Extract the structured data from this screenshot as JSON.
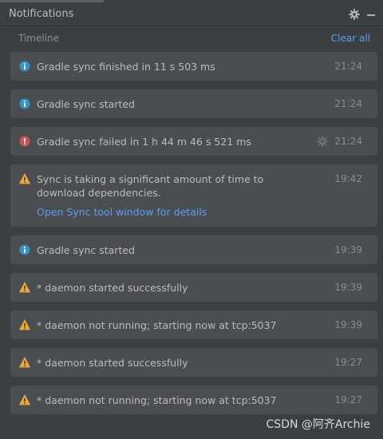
{
  "header": {
    "title": "Notifications"
  },
  "subheader": {
    "timeline_label": "Timeline",
    "clear_all_label": "Clear all"
  },
  "notifications": [
    {
      "type": "info",
      "icon": "info-icon",
      "message": "Gradle sync finished in 11 s 503 ms",
      "time": "21:24"
    },
    {
      "type": "info",
      "icon": "info-icon",
      "message": "Gradle sync started",
      "time": "21:24"
    },
    {
      "type": "error",
      "icon": "error-icon",
      "message": "Gradle sync failed in 1 h 44 m 46 s 521 ms",
      "time": "21:24"
    },
    {
      "type": "warning",
      "icon": "warning-icon",
      "message": "Sync is taking a significant amount of time to download dependencies.",
      "link": "Open Sync tool window for details",
      "time": "19:42"
    },
    {
      "type": "info",
      "icon": "info-icon",
      "message": "Gradle sync started",
      "time": "19:39"
    },
    {
      "type": "warning",
      "icon": "warning-icon",
      "message": "* daemon started successfully",
      "time": "19:39"
    },
    {
      "type": "warning",
      "icon": "warning-icon",
      "message": "* daemon not running; starting now at tcp:5037",
      "time": "19:39"
    },
    {
      "type": "warning",
      "icon": "warning-icon",
      "message": "* daemon started successfully",
      "time": "19:27"
    },
    {
      "type": "warning",
      "icon": "warning-icon",
      "message": "* daemon not running; starting now at tcp:5037",
      "time": "19:27"
    }
  ],
  "watermark": "CSDN @阿齐Archie",
  "colors": {
    "background": "#3c3f41",
    "card": "#4b4e50",
    "text": "#bbbbbb",
    "muted": "#8c8c8c",
    "link": "#589df6",
    "info": "#3592c4",
    "error": "#c75450",
    "warning": "#f0a732"
  }
}
